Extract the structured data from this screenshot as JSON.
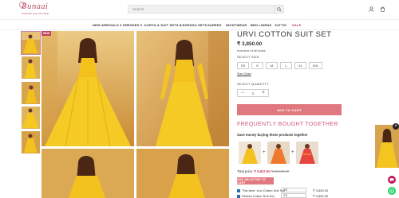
{
  "brand": {
    "name": "Bunaai",
    "tagline": "Celebrate your Own Style"
  },
  "search": {
    "placeholder": "Search"
  },
  "nav": [
    {
      "label": "NEW ARRIVALS ▾"
    },
    {
      "label": "DRESSES ▾"
    },
    {
      "label": "KURTA & SUIT SETS ▾"
    },
    {
      "label": "LEHENGA SETS"
    },
    {
      "label": "SAREES"
    },
    {
      "label": "NIGHTWEAR"
    },
    {
      "label": "BED LINENS"
    },
    {
      "label": "JUTTIS"
    },
    {
      "label": "SALE"
    }
  ],
  "gallery": {
    "badge": "NEW"
  },
  "product": {
    "title": "URVI COTTON SUIT SET",
    "price": "₹ 3,850.00",
    "tax_note": "Inclusive of all taxes",
    "size_label": "SELECT SIZE",
    "sizes": [
      "XS",
      "S",
      "M",
      "L",
      "XL",
      "XXL"
    ],
    "size_chart": "Size Chart",
    "quantity_label": "SELECT QUANTITY",
    "quantity": "1",
    "add_to_cart": "ADD TO CART"
  },
  "fbt": {
    "title": "FREQUENTLY BOUGHT TOGETHER",
    "subtitle": "Save money buying these products together",
    "total_label": "Total price:",
    "total_price": "₹ 9,847.50",
    "total_compare": "₹ 10,550.00",
    "add_button": "ADD SELECTED TO CART",
    "items": [
      {
        "label": "This item: Urvi Cotton Suit Set",
        "option": "XS",
        "price": "₹ 3,850.00"
      },
      {
        "label": "Rekhta Cotton Suit Set",
        "option": "XS",
        "price": "₹ 3,850.00"
      }
    ]
  },
  "colors": {
    "accent": "#e0787f",
    "brand": "#b5475f",
    "heading": "#cf5b79",
    "garment": "#f3c21e"
  }
}
